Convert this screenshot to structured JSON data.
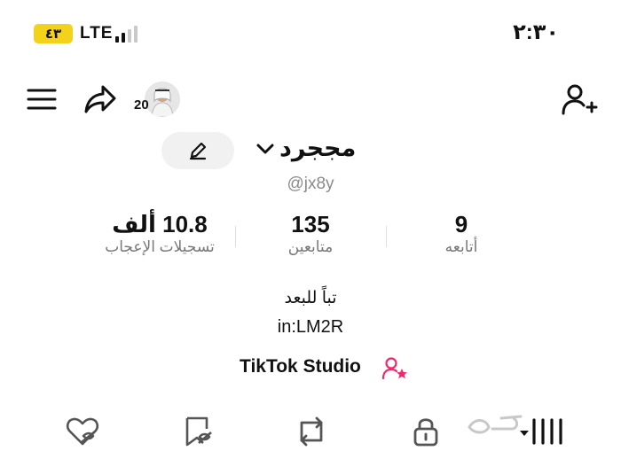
{
  "status_bar": {
    "time": "٢:٣٠",
    "battery": "٤٣",
    "network": "LTE"
  },
  "profile": {
    "avatar_badge": "20",
    "username": "مججرد",
    "handle": "@jx8y",
    "stats": [
      {
        "value": "9",
        "label": "أتابعه"
      },
      {
        "value": "135",
        "label": "متابعين"
      },
      {
        "value": "10.8 ألف",
        "label": "تسجيلات الإعجاب"
      }
    ],
    "bio_line1": "تباً للبعد",
    "bio_line2": "in:LM2R",
    "studio_link": "TikTok Studio"
  },
  "colors": {
    "accent": "#f0286e",
    "battery": "#f2d21b",
    "text": "#111111",
    "muted": "#777777"
  },
  "icons": {
    "menu": "menu-icon",
    "share": "share-icon",
    "add_friend": "add-user-icon",
    "edit": "pencil-icon",
    "studio": "creator-icon",
    "tabs": [
      "liked-heart-icon",
      "favorites-icon",
      "repost-icon",
      "private-lock-icon",
      "videos-grid-icon"
    ]
  }
}
